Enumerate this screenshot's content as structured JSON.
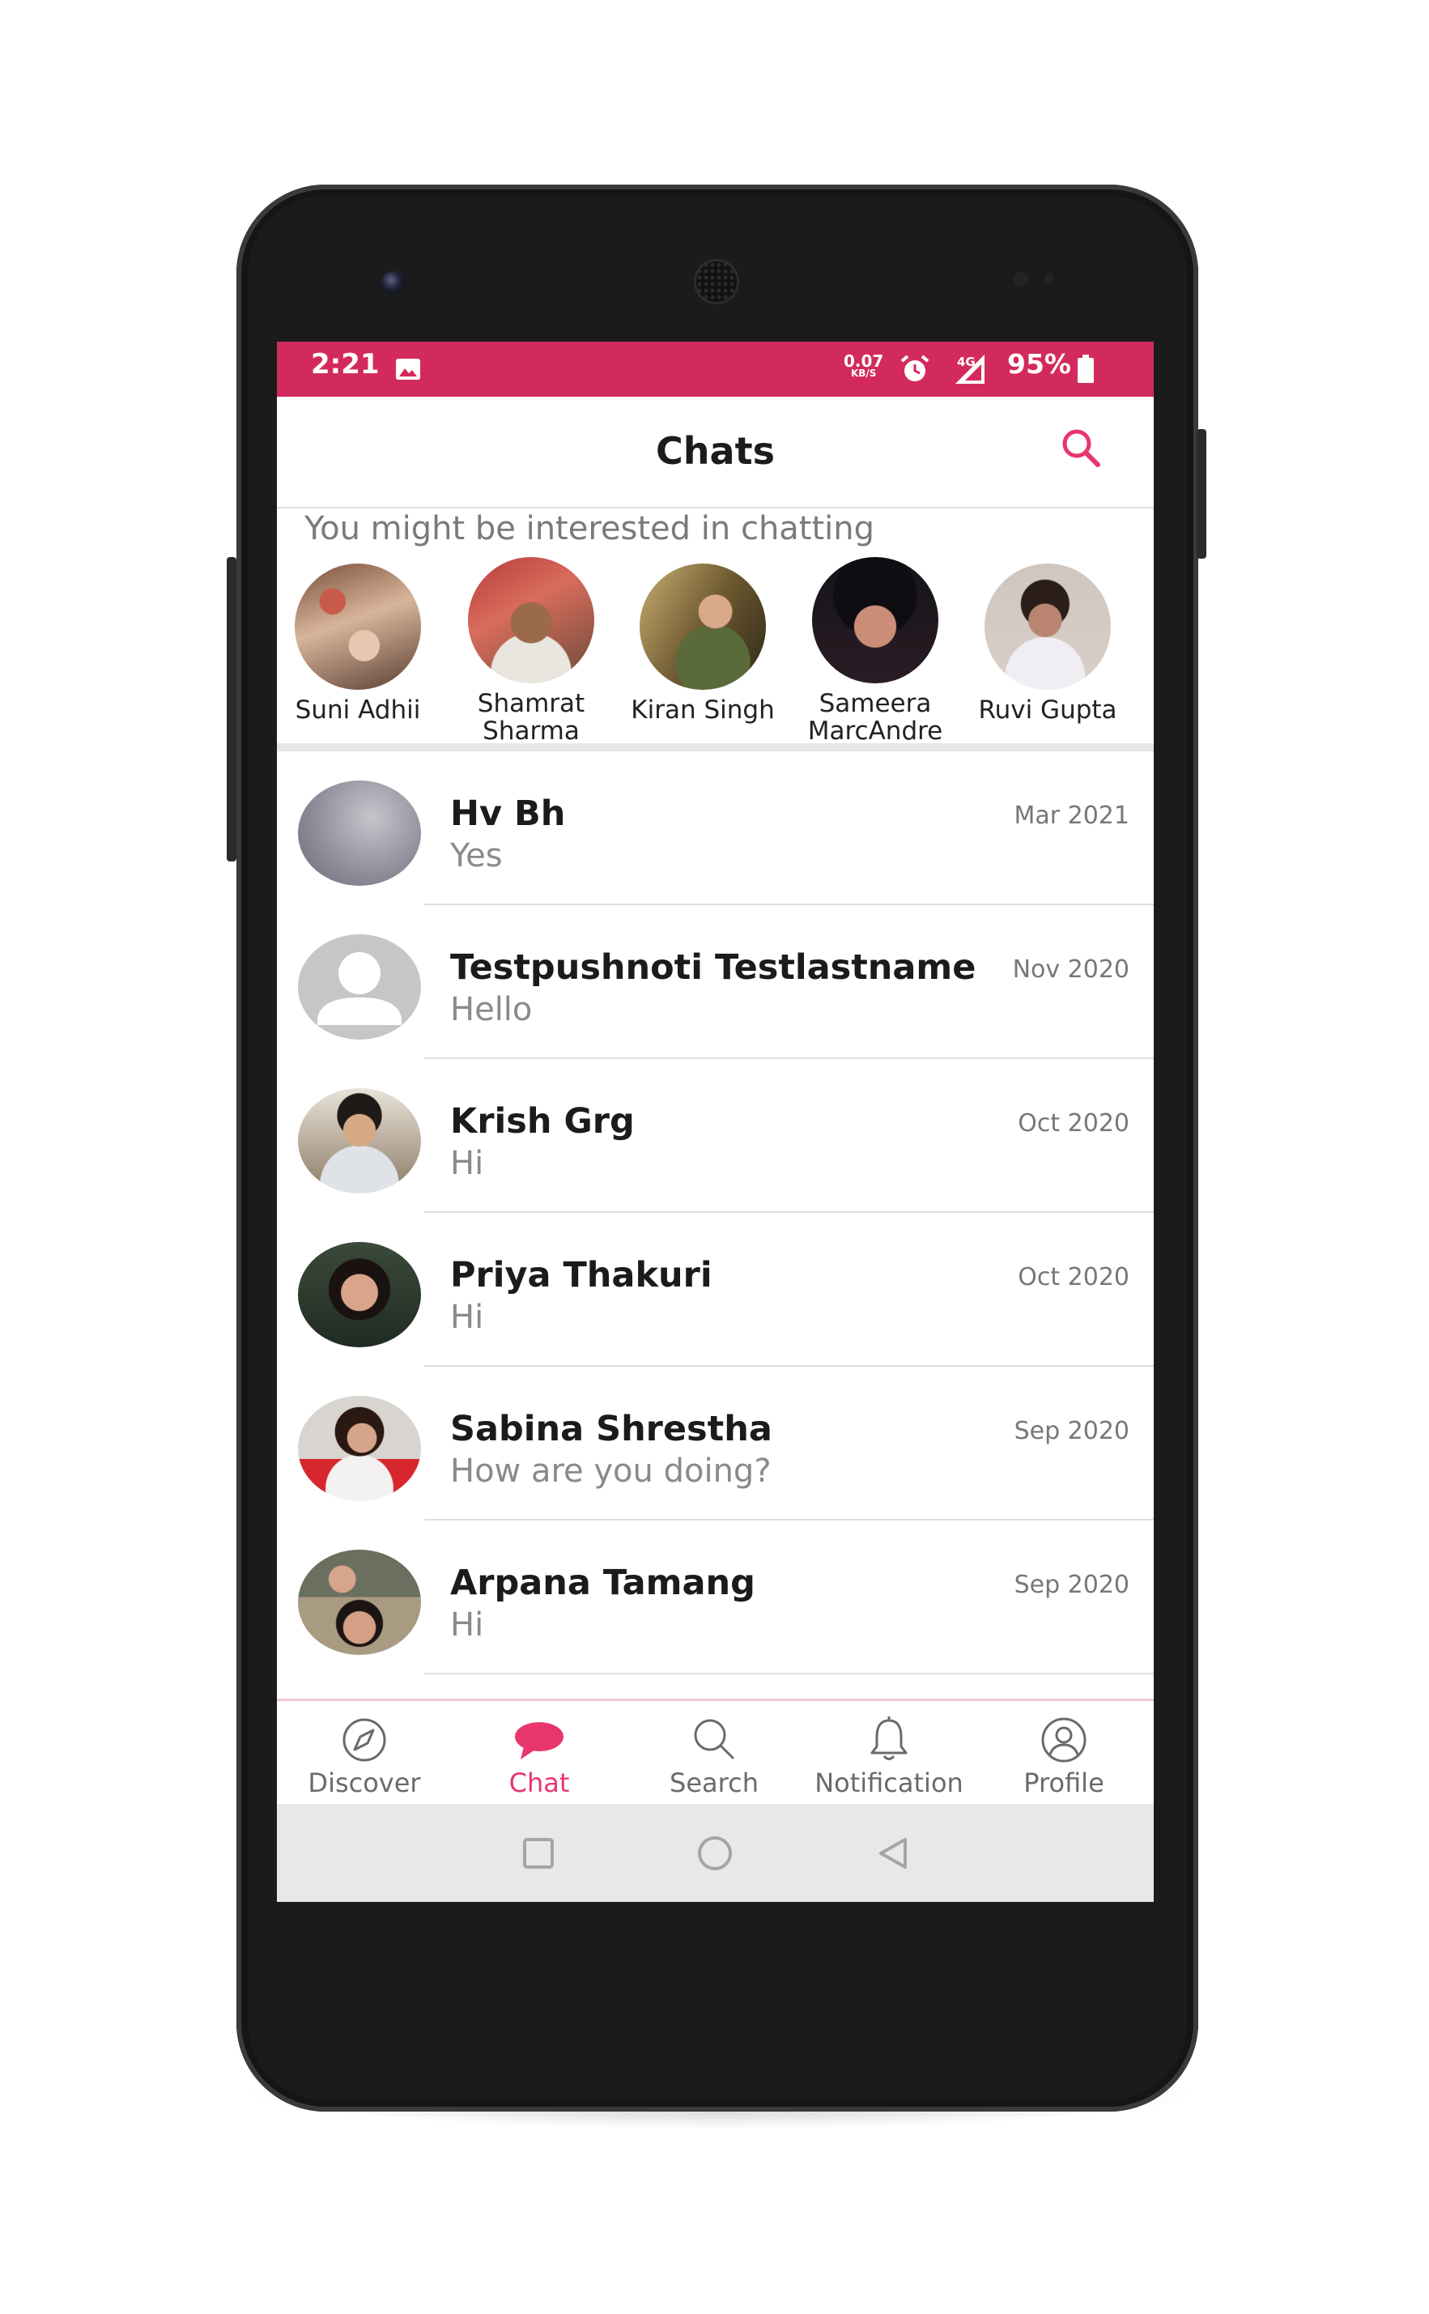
{
  "status_bar": {
    "time": "2:21",
    "net_speed": "0.07",
    "net_speed_unit": "KB/S",
    "network": "4G",
    "battery": "95%",
    "background_color": "#d32a5d"
  },
  "header": {
    "title": "Chats",
    "search_icon": "search-icon"
  },
  "suggestions": {
    "title": "You might be interested in chatting",
    "people": [
      {
        "name": "Suni Adhii"
      },
      {
        "name": "Shamrat Sharma"
      },
      {
        "name": "Kiran Singh"
      },
      {
        "name": "Sameera MarcAndre"
      },
      {
        "name": "Ruvi Gupta"
      }
    ]
  },
  "chats": [
    {
      "name": "Hv Bh",
      "message": "Yes",
      "date": "Mar 2021"
    },
    {
      "name": "Testpushnoti Testlastname",
      "message": "Hello",
      "date": "Nov 2020"
    },
    {
      "name": "Krish Grg",
      "message": "Hi",
      "date": "Oct 2020"
    },
    {
      "name": "Priya Thakuri",
      "message": "Hi",
      "date": "Oct 2020"
    },
    {
      "name": "Sabina Shrestha",
      "message": "How are you doing?",
      "date": "Sep 2020"
    },
    {
      "name": "Arpana Tamang",
      "message": "Hi",
      "date": "Sep 2020"
    }
  ],
  "bottom_nav": {
    "items": [
      {
        "label": "Discover",
        "icon": "compass-icon"
      },
      {
        "label": "Chat",
        "icon": "chat-bubble-icon"
      },
      {
        "label": "Search",
        "icon": "search-icon"
      },
      {
        "label": "Notification",
        "icon": "bell-icon"
      },
      {
        "label": "Profile",
        "icon": "user-circle-icon"
      }
    ],
    "active": "Chat"
  },
  "colors": {
    "accent": "#e8366d",
    "status_bar": "#d32a5d",
    "nav_inactive": "#6a6a6a"
  }
}
